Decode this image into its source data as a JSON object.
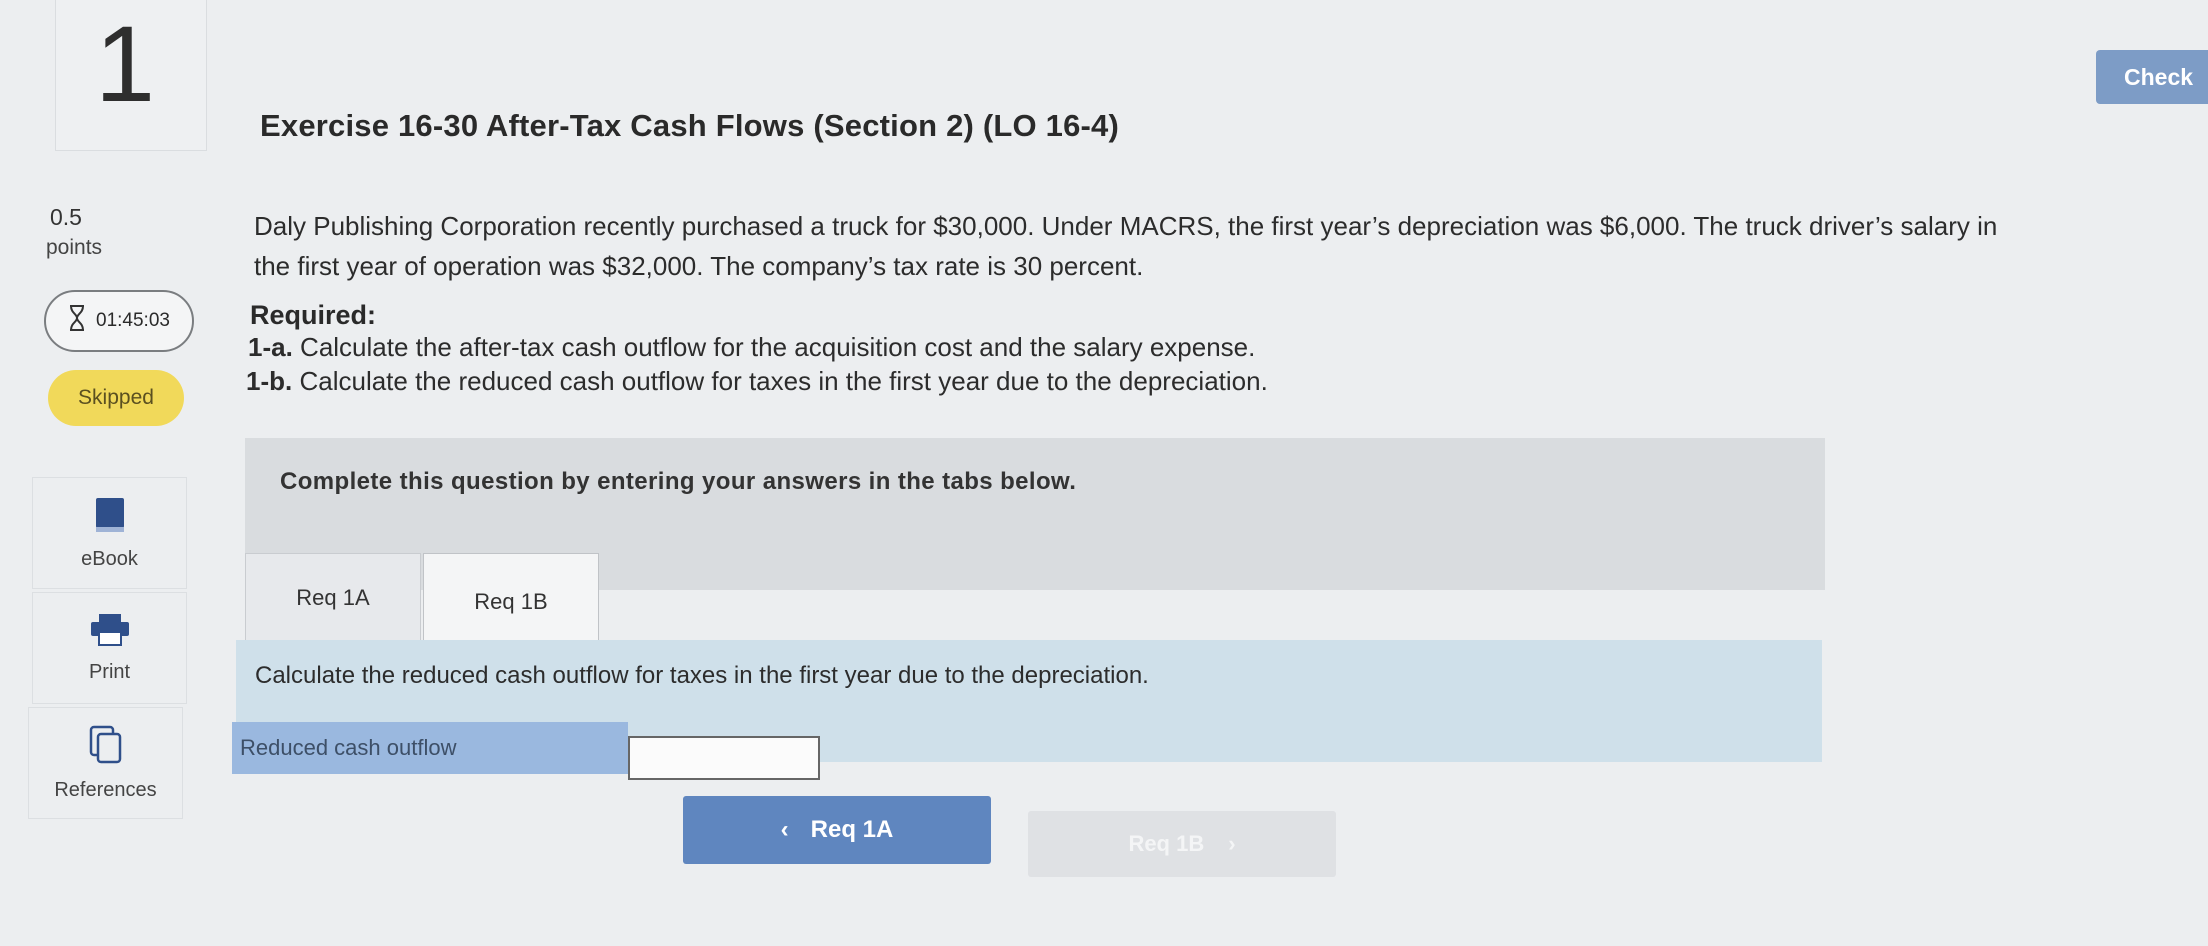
{
  "question": {
    "number": "1",
    "points_value": "0.5",
    "points_label": "points",
    "timer": "01:45:03",
    "status": "Skipped"
  },
  "tools": {
    "ebook": "eBook",
    "print": "Print",
    "references": "References"
  },
  "header": {
    "check_label": "Check"
  },
  "exercise": {
    "title": "Exercise 16-30 After-Tax Cash Flows (Section 2) (LO 16-4)",
    "paragraph": "Daly Publishing Corporation recently purchased a truck for $30,000. Under MACRS, the first year’s depreciation was $6,000. The truck driver’s salary in the first year of operation was $32,000. The company’s tax rate is 30 percent.",
    "required_label": "Required:",
    "req_1a_prefix": "1-a.",
    "req_1a_text": "Calculate the after-tax cash outflow for the acquisition cost and the salary expense.",
    "req_1b_prefix": "1-b.",
    "req_1b_text": "Calculate the reduced cash outflow for taxes in the first year due to the depreciation."
  },
  "answer_panel": {
    "instruction": "Complete this question by entering your answers in the tabs below.",
    "tabs": [
      {
        "label": "Req 1A"
      },
      {
        "label": "Req 1B"
      }
    ],
    "active_tab": "Req 1B",
    "tab_instruction": "Calculate the reduced cash outflow for taxes in the first year due to the depreciation.",
    "field_label": "Reduced cash outflow",
    "field_value": "",
    "prev_label": "Req 1A",
    "next_label": "Req 1B"
  },
  "colors": {
    "primary_button": "#5f86bf",
    "check_button": "#7d9cc6",
    "skipped_badge": "#f1d95a",
    "instruction_band": "#cfe0ea",
    "field_label_bg": "#9ab8df"
  }
}
